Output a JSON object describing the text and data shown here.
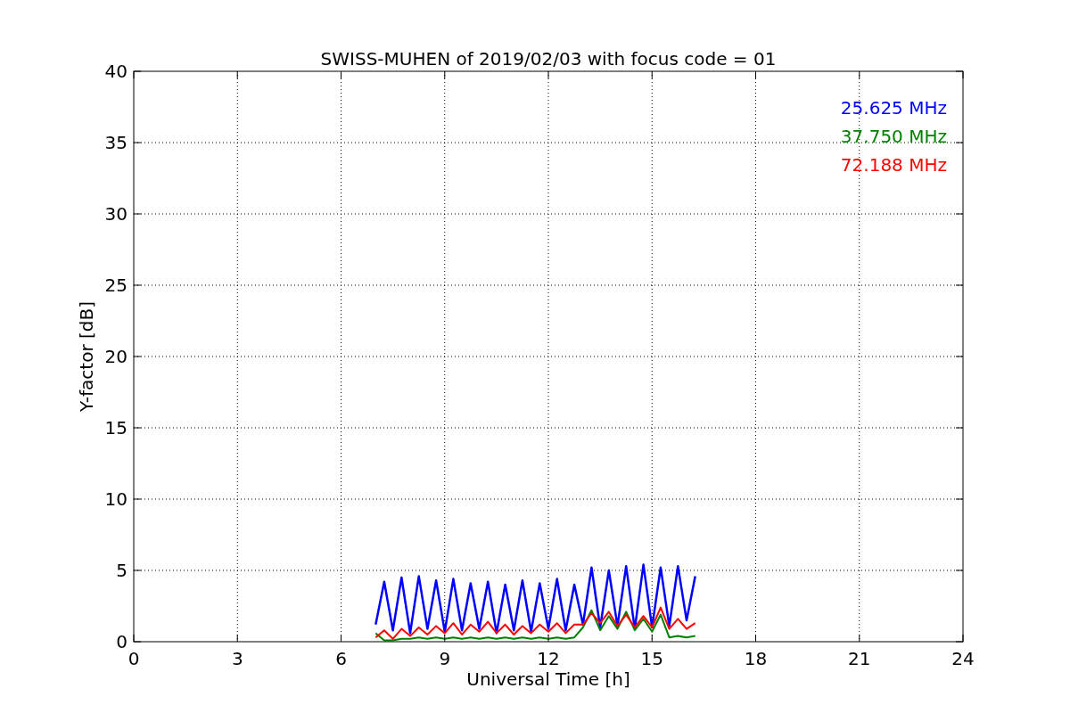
{
  "chart_data": {
    "type": "line",
    "title": "SWISS-MUHEN of 2019/02/03 with focus code = 01",
    "xlabel": "Universal Time [h]",
    "ylabel": "Y-factor [dB]",
    "grid": true,
    "xlim": [
      0,
      24
    ],
    "ylim": [
      0,
      40
    ],
    "xticks": [
      0,
      3,
      6,
      9,
      12,
      15,
      18,
      21,
      24
    ],
    "yticks": [
      0,
      5,
      10,
      15,
      20,
      25,
      30,
      35,
      40
    ],
    "x": [
      7,
      7.25,
      7.5,
      7.75,
      8,
      8.25,
      8.5,
      8.75,
      9,
      9.25,
      9.5,
      9.75,
      10,
      10.25,
      10.5,
      10.75,
      11,
      11.25,
      11.5,
      11.75,
      12,
      12.25,
      12.5,
      12.75,
      13,
      13.25,
      13.5,
      13.75,
      14,
      14.25,
      14.5,
      14.75,
      15,
      15.25,
      15.5,
      15.75,
      16,
      16.25
    ],
    "series": [
      {
        "name": "25.625 MHz",
        "color": "#0000ff",
        "values": [
          1.2,
          4.2,
          0.8,
          4.5,
          0.6,
          4.6,
          0.9,
          4.3,
          0.7,
          4.4,
          0.8,
          4.1,
          0.9,
          4.2,
          0.6,
          4.0,
          0.8,
          4.3,
          0.7,
          4.1,
          0.9,
          4.4,
          0.8,
          4.0,
          1.2,
          5.2,
          1.0,
          5.0,
          1.1,
          5.3,
          0.9,
          5.4,
          1.0,
          5.2,
          1.1,
          5.3,
          1.5,
          4.6
        ]
      },
      {
        "name": "37.750 MHz",
        "color": "#008000",
        "values": [
          0.6,
          0.1,
          0.1,
          0.2,
          0.2,
          0.3,
          0.2,
          0.3,
          0.2,
          0.3,
          0.2,
          0.3,
          0.2,
          0.3,
          0.2,
          0.3,
          0.2,
          0.3,
          0.2,
          0.3,
          0.2,
          0.3,
          0.2,
          0.3,
          1.0,
          2.2,
          0.8,
          1.8,
          0.9,
          2.1,
          0.8,
          1.6,
          0.7,
          1.9,
          0.3,
          0.4,
          0.3,
          0.4
        ]
      },
      {
        "name": "72.188 MHz",
        "color": "#ff0000",
        "values": [
          0.3,
          0.8,
          0.2,
          0.9,
          0.4,
          1.0,
          0.5,
          1.1,
          0.6,
          1.3,
          0.5,
          1.2,
          0.7,
          1.4,
          0.6,
          1.2,
          0.5,
          1.1,
          0.6,
          1.2,
          0.7,
          1.3,
          0.6,
          1.2,
          1.2,
          2.0,
          1.3,
          2.1,
          1.1,
          1.9,
          1.0,
          1.8,
          1.0,
          2.4,
          0.9,
          1.6,
          0.9,
          1.3
        ]
      }
    ]
  }
}
